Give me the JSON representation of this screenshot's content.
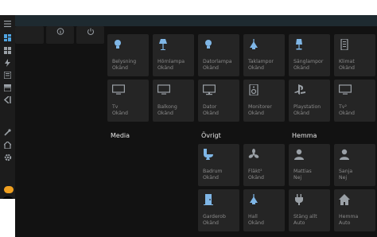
{
  "colors": {
    "accent": "#4fa3e0",
    "bulb": "#7fb6e6"
  },
  "sidebar": {
    "icons": [
      "menu-icon",
      "dashboard-icon",
      "map-icon",
      "energy-icon",
      "logbook-icon",
      "history-icon",
      "vscode-icon",
      "tools-icon",
      "home-assistant-icon",
      "settings-icon"
    ]
  },
  "top_row": [
    {
      "icon": "info-icon"
    },
    {
      "icon": "power-icon"
    }
  ],
  "group1": [
    {
      "name": "Belysning",
      "state": "Okänd",
      "icon": "bulb-icon"
    },
    {
      "name": "Hörnlampa",
      "state": "Okänd",
      "icon": "floor-lamp-icon"
    },
    {
      "name": "Datorlampa",
      "state": "Okänd",
      "icon": "bulb-icon"
    },
    {
      "name": "Taklampor",
      "state": "Okänd",
      "icon": "ceiling-light-icon"
    },
    {
      "name": "Sänglampor",
      "state": "Okänd",
      "icon": "lamp-icon"
    },
    {
      "name": "Klimat",
      "state": "Okänd",
      "icon": "remote-icon"
    },
    {
      "name": "Tv",
      "state": "Okänd",
      "icon": "tv-icon"
    },
    {
      "name": "Balkong",
      "state": "Okänd",
      "icon": "tv-icon"
    },
    {
      "name": "Dator",
      "state": "Okänd",
      "icon": "monitor-icon"
    },
    {
      "name": "Monitorer",
      "state": "Okänd",
      "icon": "speaker-icon"
    },
    {
      "name": "Playstation",
      "state": "Okänd",
      "icon": "playstation-icon"
    },
    {
      "name": "Tv²",
      "state": "Okänd",
      "icon": "tv-icon"
    }
  ],
  "sections": {
    "media": "Media",
    "ovrigt": "Övrigt",
    "hemma": "Hemma"
  },
  "group2": [
    {
      "name": "Badrum",
      "state": "Okänd",
      "icon": "toilet-icon"
    },
    {
      "name": "Fläkt²",
      "state": "Okänd",
      "icon": "fan-icon"
    },
    {
      "name": "Mattias",
      "state": "Nej",
      "icon": "account-icon"
    },
    {
      "name": "Sanja",
      "state": "Nej",
      "icon": "account-icon"
    },
    {
      "name": "Garderob",
      "state": "Okänd",
      "icon": "door-icon"
    },
    {
      "name": "Hall",
      "state": "Okänd",
      "icon": "ceiling-light-icon"
    },
    {
      "name": "Stäng allt",
      "state": "Auto",
      "icon": "power-plug-icon"
    },
    {
      "name": "Hemma",
      "state": "Auto",
      "icon": "home-icon"
    }
  ]
}
